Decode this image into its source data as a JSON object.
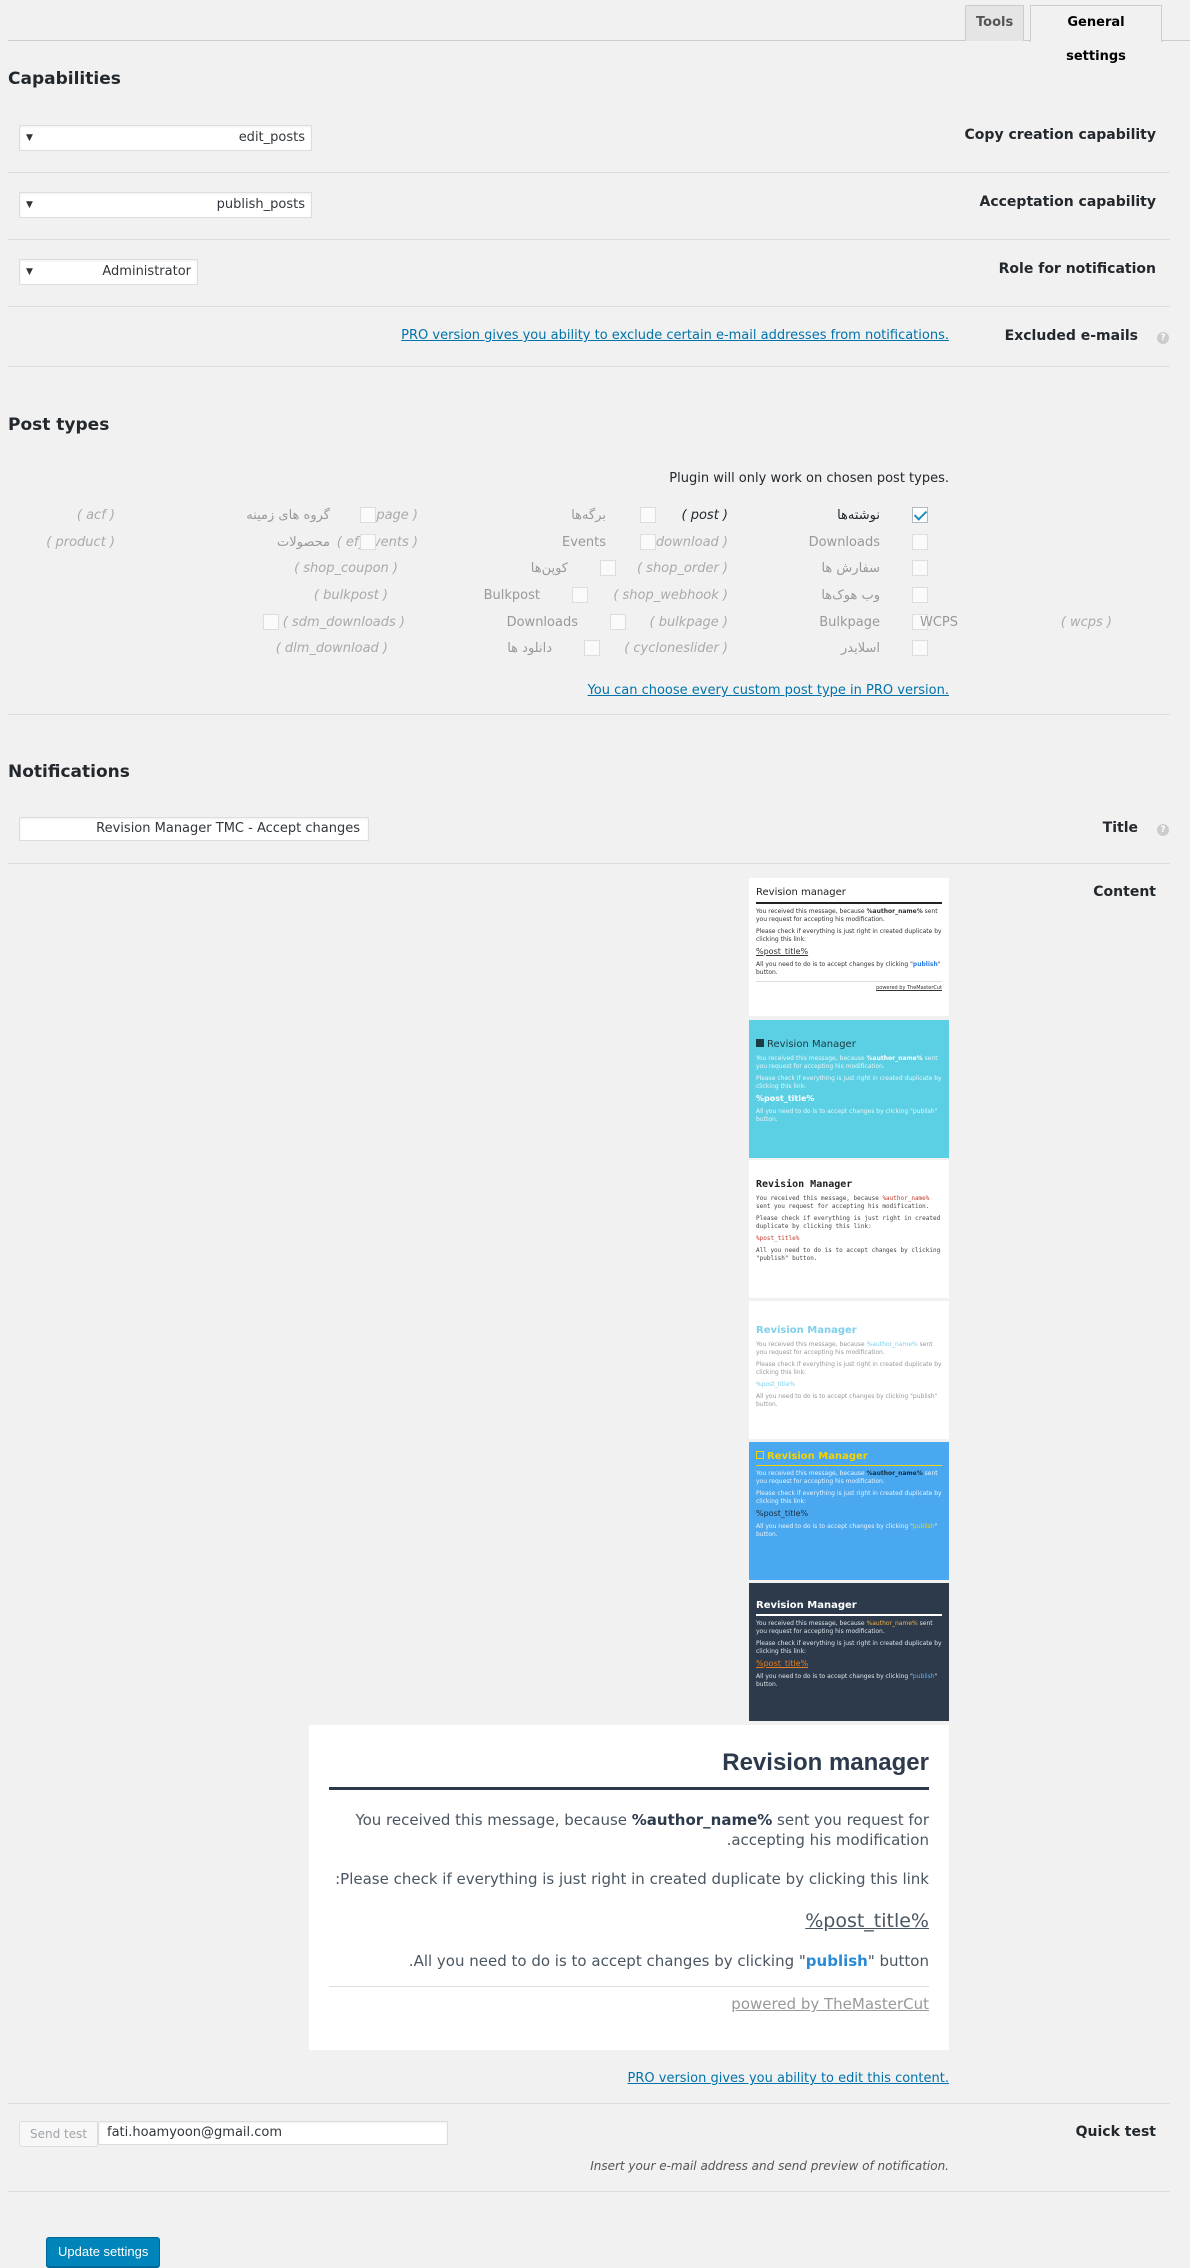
{
  "tabs": [
    {
      "label": "Tools",
      "active": false
    },
    {
      "label": "General settings",
      "active": true
    }
  ],
  "capabilities": {
    "heading": "Capabilities",
    "rows": [
      {
        "label": "Copy creation capability",
        "value": "edit_posts"
      },
      {
        "label": "Acceptation capability",
        "value": "publish_posts"
      },
      {
        "label": "Role for notification",
        "value": "Administrator"
      }
    ],
    "excluded": {
      "label": "Excluded e-mails",
      "link": "PRO version gives you ability to exclude certain e-mail addresses from notifications."
    }
  },
  "post_types": {
    "heading": "Post types",
    "note": "Plugin will only work on chosen post types.",
    "rows": [
      [
        {
          "label": "نوشته‌ها",
          "slug": "( post )",
          "checked": true
        },
        {
          "label": "برگه‌ها",
          "slug": "( page )",
          "checked": false
        },
        {
          "label": "گروه های زمینه",
          "slug": "( acf )",
          "checked": false
        }
      ],
      [
        {
          "label": "Downloads",
          "slug": "( download )",
          "checked": false
        },
        {
          "label": "Events",
          "slug": "( ef_events )",
          "checked": false
        },
        {
          "label": "محصولات",
          "slug": "( product )",
          "checked": false
        }
      ],
      [
        {
          "label": "سفارش ها",
          "slug": "( shop_order )",
          "checked": false
        },
        {
          "label": "کوپن‌ها",
          "slug": "( shop_coupon )",
          "checked": false
        }
      ],
      [
        {
          "label": "وب هوک‌ها",
          "slug": "( shop_webhook )",
          "checked": false
        },
        {
          "label": "Bulkpost",
          "slug": "( bulkpost )",
          "checked": false
        }
      ],
      [
        {
          "label": "Bulkpage",
          "slug": "( bulkpage )",
          "checked": false
        },
        {
          "label": "Downloads",
          "slug": "( sdm_downloads )",
          "checked": false
        },
        {
          "label": "WCPS",
          "slug": "( wcps )",
          "checked": false
        }
      ],
      [
        {
          "label": "اسلایدر",
          "slug": "( cycloneslider )",
          "checked": false
        },
        {
          "label": "دانلود ها",
          "slug": "( dlm_download )",
          "checked": false
        }
      ]
    ],
    "pro_link": "You can choose every custom post type in PRO version."
  },
  "notifications": {
    "heading": "Notifications",
    "title_label": "Title",
    "title_value": "Revision Manager TMC - Accept changes",
    "content_label": "Content",
    "templates": [
      {
        "name": "default",
        "title": "Revision manager",
        "accent": "#222222",
        "bg": "#ffffff"
      },
      {
        "name": "cyan",
        "title": "Revision Manager",
        "accent": "#ffffff",
        "bg": "#5bcfe3"
      },
      {
        "name": "mono",
        "title": "Revision Manager",
        "accent": "#c0392b",
        "bg": "#ffffff"
      },
      {
        "name": "light",
        "title": "Revision Manager",
        "accent": "#7fd0ea",
        "bg": "#ffffff"
      },
      {
        "name": "blue",
        "title": "Revision Manager",
        "accent": "#f5d300",
        "bg": "#4aa8f0"
      },
      {
        "name": "dark",
        "title": "Revision Manager",
        "accent": "#e67e22",
        "bg": "#2c3a4b"
      }
    ],
    "template_text": {
      "line1_pre": "You received this message, because ",
      "author": "%author_name%",
      "line1_post": " sent you request for accepting his modification.",
      "line2": "Please check if everything is just right in created duplicate by clicking this link:",
      "post_title": "%post_title%",
      "line3_pre": "All you need to do is to accept changes by clicking \"",
      "publish": "publish",
      "line3_post": "\" button.",
      "powered": "powered by TheMasterCut"
    },
    "preview": {
      "title": "Revision manager",
      "line1_pre": "You received this message, because ",
      "author": "%author_name%",
      "line1_post": " sent you request for accepting his modification.",
      "line2": "Please check if everything is just right in created duplicate by clicking this link:",
      "post_title": "%post_title%",
      "line3_pre": "All you need to do is to accept changes by clicking \"",
      "publish": "publish",
      "line3_post": "\" button.",
      "powered": "powered by TheMasterCut"
    },
    "pro_link": "PRO version gives you ability to edit this content."
  },
  "quick_test": {
    "label": "Quick test",
    "button": "Send test",
    "email": "fati.hoamyoon@gmail.com",
    "hint": "Insert your e-mail address and send preview of notification."
  },
  "update_button": "Update settings",
  "colors": {
    "accent": "#0085ba",
    "link": "#0073aa",
    "check": "#1e8cbe"
  }
}
